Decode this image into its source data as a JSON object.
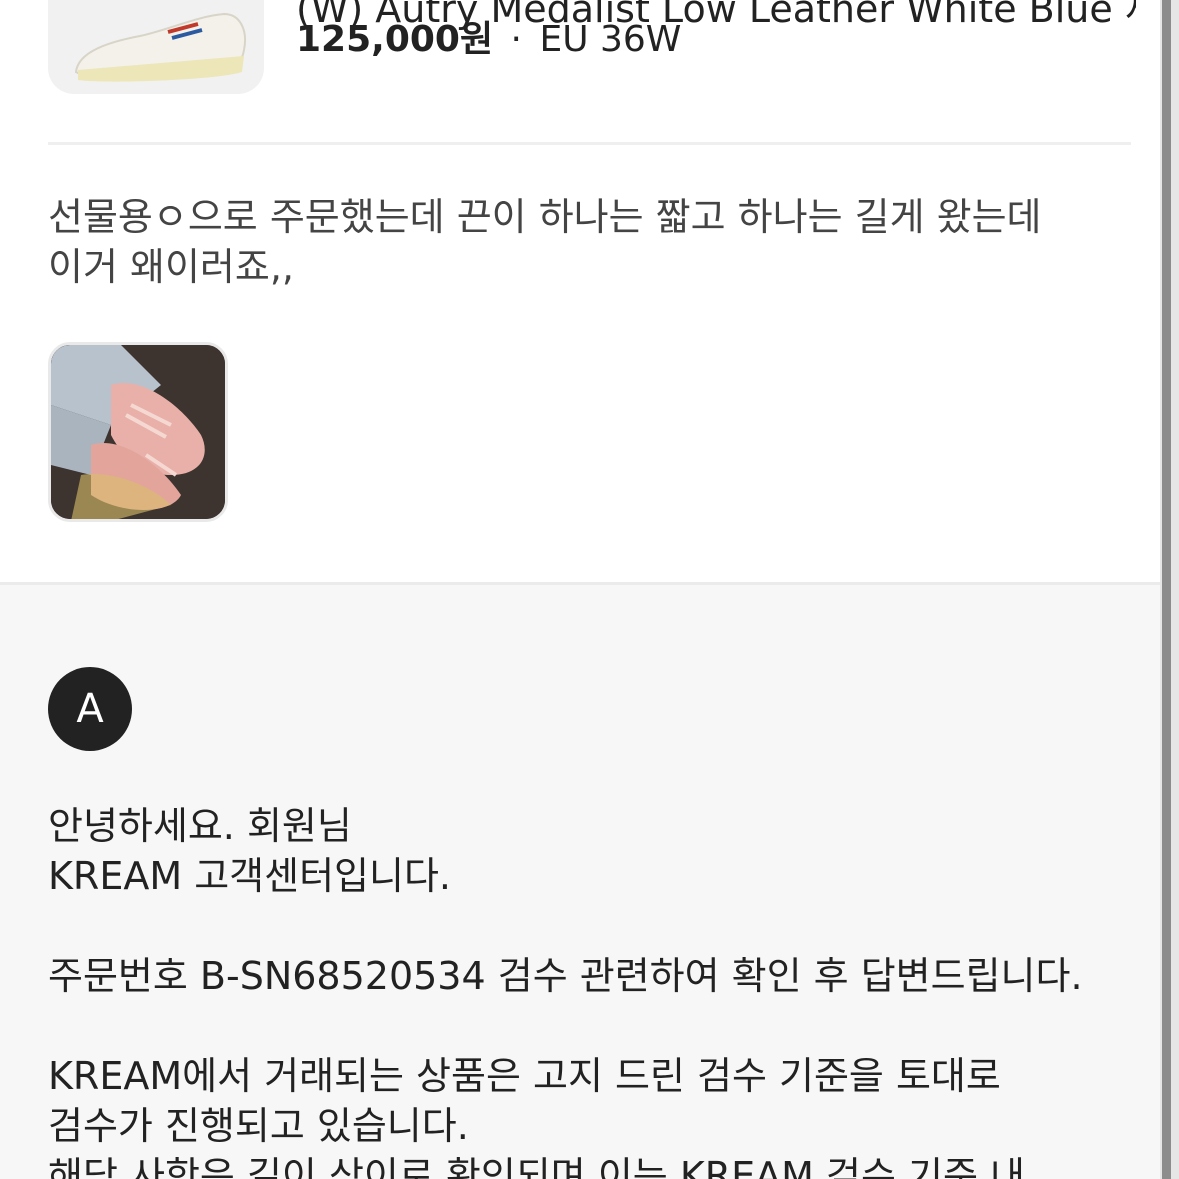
{
  "product": {
    "name": "(W) Autry Medalist Low Leather White Blue 재발행",
    "price": "125,000원",
    "separator": "·",
    "size": "EU 36W",
    "thumb_icon": "sneaker-image"
  },
  "inquiry": {
    "text": "선물용ㅇ으로 주문했는데 끈이 하나는 짧고 하나는 길게 왔는데\n이거 왜이러죠,,",
    "attachment_icon": "photo-thumbnail"
  },
  "answer": {
    "avatar_letter": "A",
    "text": "안녕하세요. 회원님\nKREAM 고객센터입니다.\n\n주문번호 B-SN68520534 검수 관련하여 확인 후 답변드립니다.\n\nKREAM에서 거래되는 상품은 고지 드린 검수 기준을 토대로\n검수가 진행되고 있습니다.\n해당 사항은 길이 상이로 확인되며 이는 KREAM 검수 기준 내"
  },
  "colors": {
    "avatar_bg": "#222222",
    "answer_bg": "#f7f7f7",
    "divider": "#efefef"
  }
}
